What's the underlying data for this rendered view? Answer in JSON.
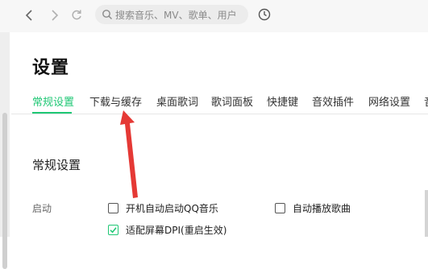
{
  "topbar": {
    "search_placeholder": "搜索音乐、MV、歌单、用户"
  },
  "page": {
    "title": "设置"
  },
  "tabs": [
    {
      "label": "常规设置",
      "active": true
    },
    {
      "label": "下载与缓存",
      "active": false
    },
    {
      "label": "桌面歌词",
      "active": false
    },
    {
      "label": "歌词面板",
      "active": false
    },
    {
      "label": "快捷键",
      "active": false
    },
    {
      "label": "音效插件",
      "active": false
    },
    {
      "label": "网络设置",
      "active": false
    },
    {
      "label": "音",
      "active": false
    }
  ],
  "general": {
    "section_title": "常规设置",
    "startup_label": "启动",
    "options": [
      {
        "label": "开机自动启动QQ音乐",
        "checked": false
      },
      {
        "label": "自动播放歌曲",
        "checked": false
      },
      {
        "label": "适配屏幕DPI(重启生效)",
        "checked": true
      }
    ]
  },
  "colors": {
    "accent": "#1ec774",
    "annotation_arrow": "#e53935"
  }
}
